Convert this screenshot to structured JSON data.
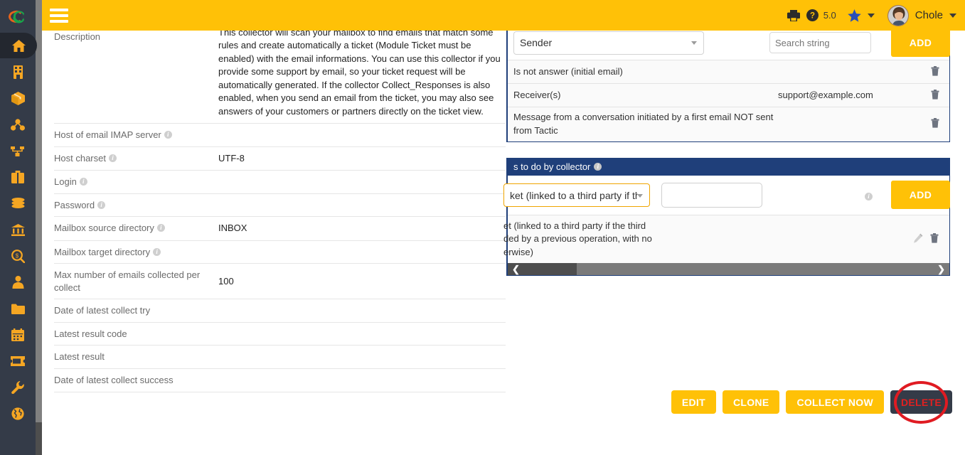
{
  "header": {
    "hamburger_icon": "hamburger-menu-icon",
    "print_icon": "printer-icon",
    "help_icon": "help-circle-icon",
    "version": "5.0",
    "star_icon": "star-icon",
    "star_caret_icon": "chevron-down-icon",
    "avatar_icon": "user-avatar",
    "user_name": "Chole",
    "user_caret_icon": "chevron-down-icon",
    "bg_color": "#ffc107"
  },
  "sidebar": {
    "logo": "tactic-logo",
    "items": [
      {
        "name": "home",
        "icon": "home-icon",
        "active": true
      },
      {
        "name": "organization",
        "icon": "building-icon",
        "active": false
      },
      {
        "name": "products",
        "icon": "box-icon",
        "active": false
      },
      {
        "name": "network",
        "icon": "network-nodes-icon",
        "active": false
      },
      {
        "name": "workflow",
        "icon": "sitemap-icon",
        "active": false
      },
      {
        "name": "business",
        "icon": "briefcase-icon",
        "active": false
      },
      {
        "name": "finance",
        "icon": "coins-icon",
        "active": false
      },
      {
        "name": "accounting",
        "icon": "bank-icon",
        "active": false
      },
      {
        "name": "search-money",
        "icon": "search-dollar-icon",
        "active": false
      },
      {
        "name": "contacts",
        "icon": "user-tie-icon",
        "active": false
      },
      {
        "name": "files",
        "icon": "folder-icon",
        "active": false
      },
      {
        "name": "calendar",
        "icon": "calendar-icon",
        "active": false
      },
      {
        "name": "tickets",
        "icon": "ticket-icon",
        "active": false
      },
      {
        "name": "tools",
        "icon": "wrench-icon",
        "active": false
      },
      {
        "name": "globe",
        "icon": "globe-icon",
        "active": false
      }
    ]
  },
  "form": {
    "rows": [
      {
        "label": "Description",
        "has_info": false,
        "value": "This collector will scan your mailbox to find emails that match some rules and create automatically a ticket (Module Ticket must be enabled) with the email informations. You can use this collector if you provide some support by email, so your ticket request will be automatically generated. If the collector Collect_Responses is also enabled, when you send an email from the ticket, you may also see answers of your customers or partners directly on the ticket view."
      },
      {
        "label": "Host of email IMAP server",
        "has_info": true,
        "value": ""
      },
      {
        "label": "Host charset",
        "has_info": true,
        "value": "UTF-8"
      },
      {
        "label": "Login",
        "has_info": true,
        "value": ""
      },
      {
        "label": "Password",
        "has_info": true,
        "value": ""
      },
      {
        "label": "Mailbox source directory",
        "has_info": true,
        "value": "INBOX"
      },
      {
        "label": "Mailbox target directory",
        "has_info": true,
        "value": ""
      },
      {
        "label": "Max number of emails collected per collect",
        "has_info": false,
        "value": "100"
      },
      {
        "label": "Date of latest collect try",
        "has_info": false,
        "value": ""
      },
      {
        "label": "Latest result code",
        "has_info": false,
        "value": ""
      },
      {
        "label": "Latest result",
        "has_info": false,
        "value": ""
      },
      {
        "label": "Date of latest collect success",
        "has_info": false,
        "value": ""
      }
    ]
  },
  "rules_panel": {
    "select_value": "Sender",
    "search_placeholder": "Search string",
    "search_value": "",
    "add_label": "ADD",
    "rows": [
      {
        "name": "Is not answer (initial email)",
        "value": "",
        "delete_icon": "trash-icon"
      },
      {
        "name": "Receiver(s)",
        "value": "support@example.com",
        "delete_icon": "trash-icon"
      },
      {
        "name": "Message from a conversation initiated by a first email NOT sent from Tactic",
        "value": "",
        "delete_icon": "trash-icon"
      }
    ]
  },
  "actions_panel": {
    "title": "s to do by collector",
    "title_info_icon": "info-icon",
    "select_value": "ket (linked to a third party if the thi...",
    "text_value": "",
    "info_icon": "info-icon",
    "add_label": "ADD",
    "rows": [
      {
        "name": "et (linked to a third party if the third\nded by a previous operation, with no\nerwise)",
        "edit_icon": "pencil-icon",
        "delete_icon": "trash-icon"
      }
    ],
    "scroll_left_icon": "chevron-left-icon",
    "scroll_right_icon": "chevron-right-icon",
    "bar_color": "#1f3f7a"
  },
  "footer_buttons": {
    "edit": "EDIT",
    "clone": "CLONE",
    "collect_now": "COLLECT NOW",
    "delete": "DELETE",
    "delete_highlight_color": "#e01b22"
  }
}
